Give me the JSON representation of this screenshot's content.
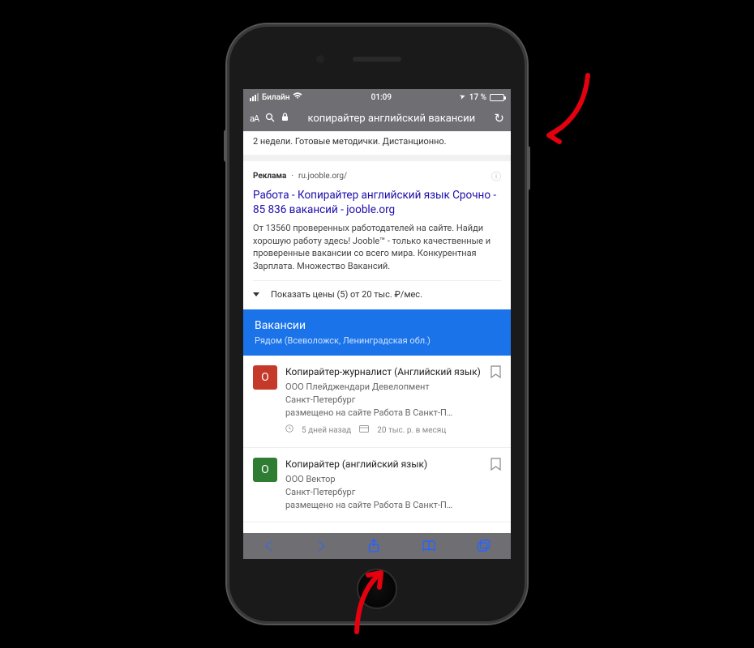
{
  "status": {
    "carrier": "Билайн",
    "time": "01:09",
    "battery_pct": "17 %"
  },
  "address_bar": {
    "text_size_label": "аА",
    "url_text": "копирайтер английский вакансии"
  },
  "snippet_top": "2 недели. Готовые методички. Дистанционно.",
  "ad": {
    "label": "Реклама",
    "domain": "ru.jooble.org/",
    "title": "Работа - Копирайтер английский язык Срочно - 85 836 вакансий - jooble.org",
    "description": "От 13560 проверенных работодателей на сайте. Найди хорошую работу здесь! Jooble™ - только качественные и проверенные вакансии со всего мира. Конкурентная Зарплата. Множество Вакансий.",
    "expand_text": "Показать цены (5) от 20 тыс. ₽/мес."
  },
  "jobs_block": {
    "title": "Вакансии",
    "subtitle": "Рядом (Всеволожск, Ленинградская обл.)",
    "items": [
      {
        "logo_letter": "О",
        "logo_class": "logo-red",
        "title": "Копирайтер-журналист (Английский язык)",
        "company": "ООО Плейджендари Девелопмент",
        "location": "Санкт-Петербург",
        "posted_on": "размещено на сайте Работа В Санкт-П…",
        "age": "5 дней назад",
        "salary": "20 тыс. р. в месяц"
      },
      {
        "logo_letter": "О",
        "logo_class": "logo-green",
        "title": "Копирайтер (английский язык)",
        "company": "ООО Вектор",
        "location": "Санкт-Петербург",
        "posted_on": "размещено на сайте Работа В Санкт-П…",
        "age": "",
        "salary": ""
      }
    ]
  },
  "icons": {
    "lock": "🔒",
    "search": "🔍",
    "reload": "↻",
    "location_arrow": "➤",
    "info": "ⓘ",
    "clock": "🕒",
    "money": "💳"
  }
}
